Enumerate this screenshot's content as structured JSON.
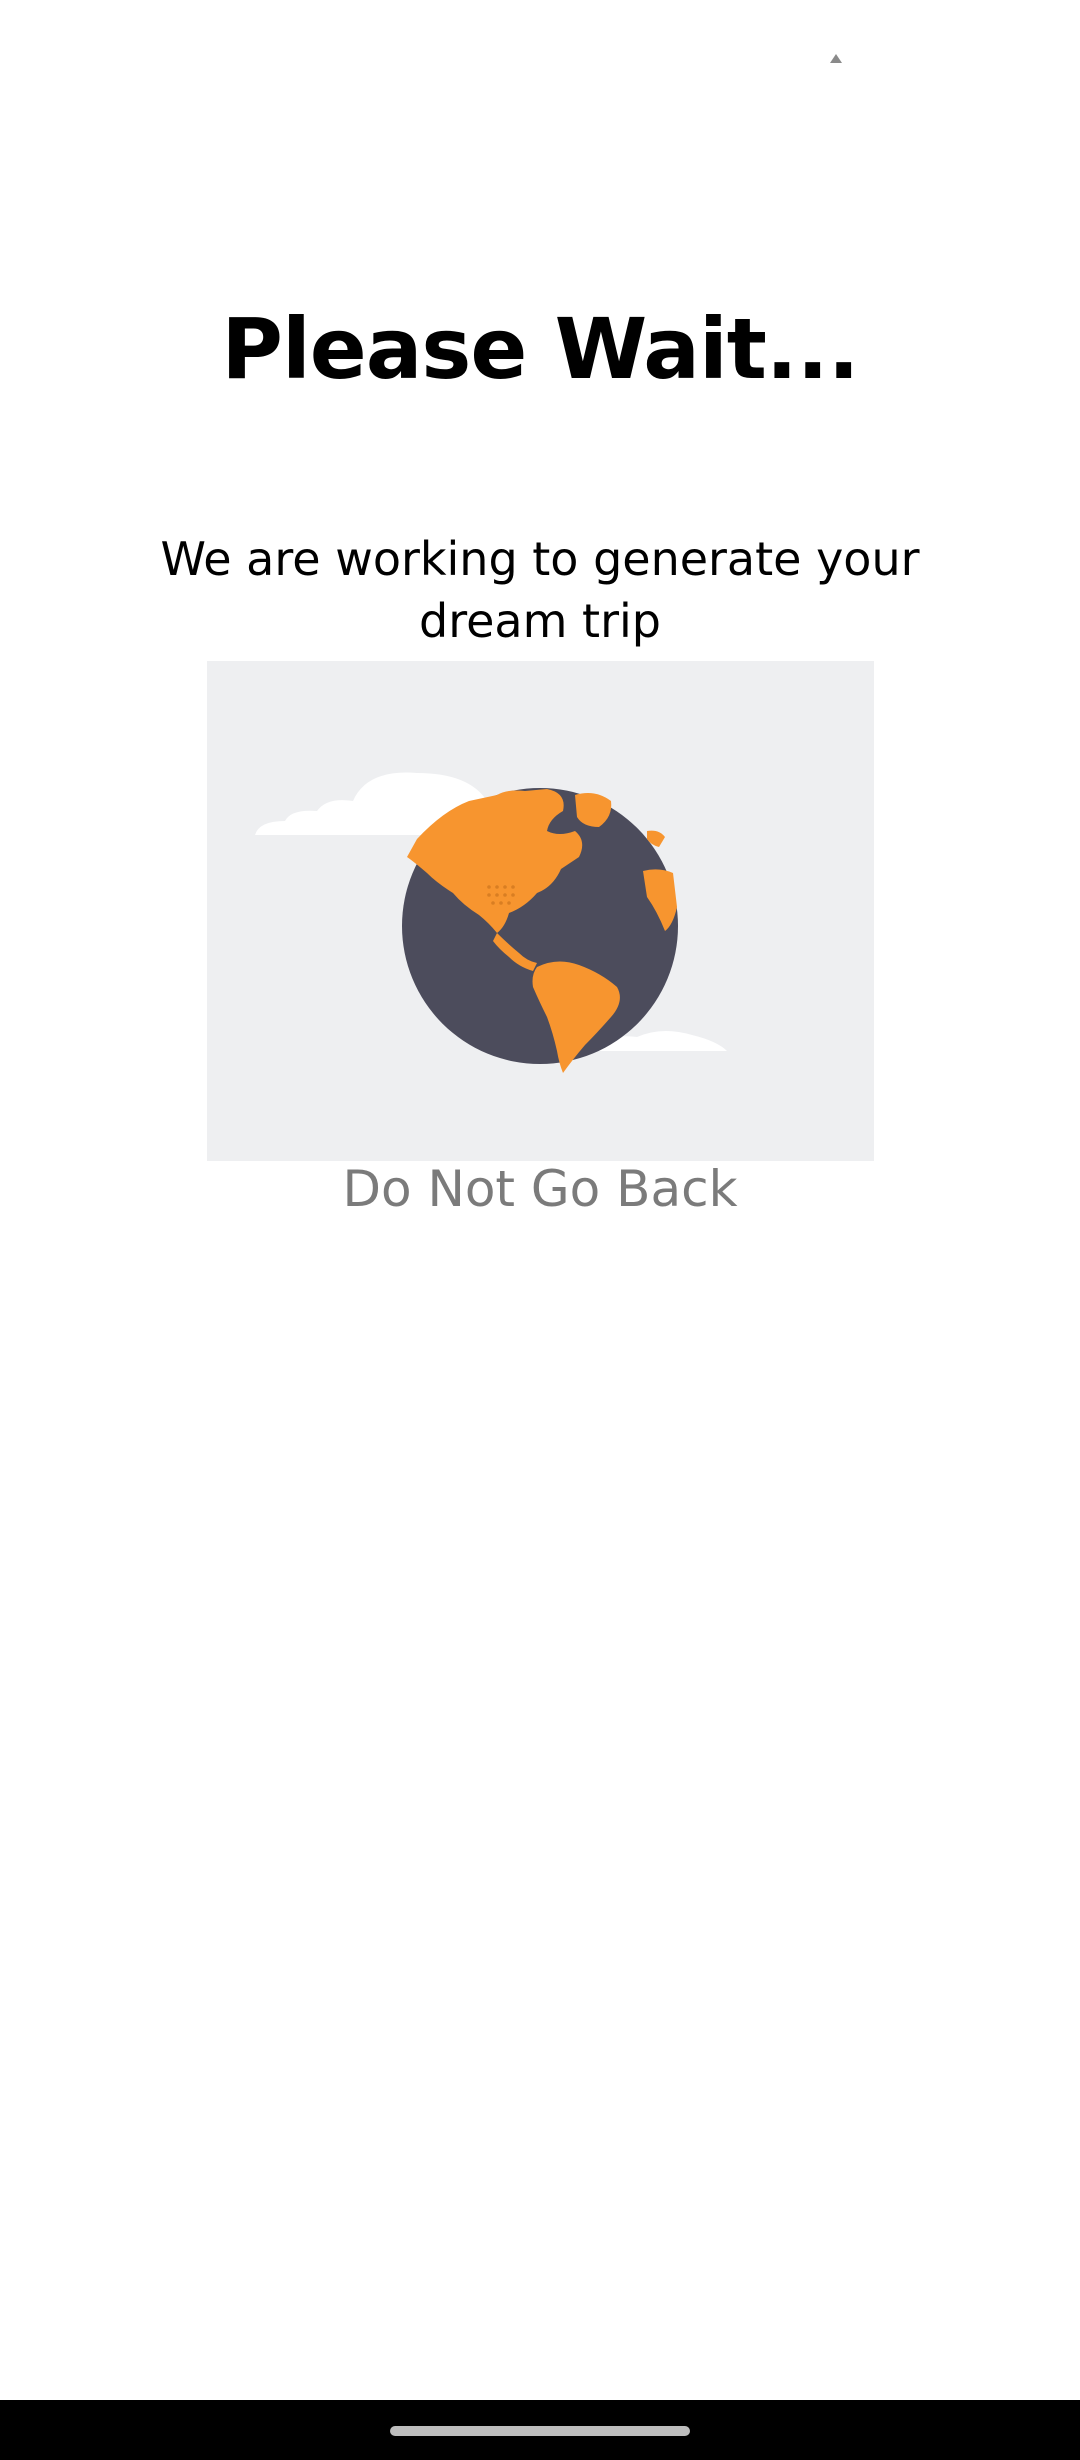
{
  "status_bar": {
    "indicator_icon": "caret-up-icon"
  },
  "loading": {
    "title": "Please Wait...",
    "subtitle": "We are working to generate your dream trip",
    "illustration_icon": "globe-icon",
    "warning": "Do Not Go Back"
  },
  "colors": {
    "globe_ocean": "#4c4c5c",
    "globe_land": "#f7952f",
    "illustration_bg": "#eeeff1",
    "warning_text": "#7b7b7b"
  },
  "nav_bar": {
    "home_indicator": "home-indicator"
  }
}
